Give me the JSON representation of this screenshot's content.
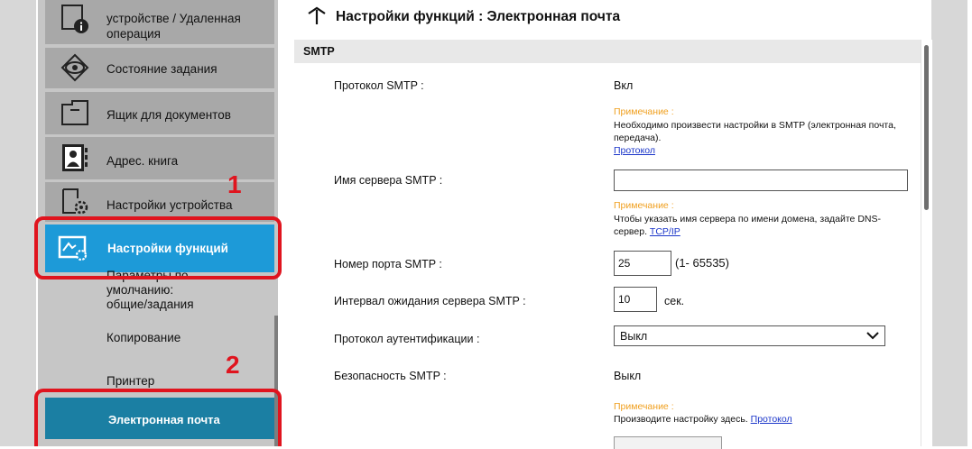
{
  "sidebar": {
    "items": [
      {
        "label_line1": "устройстве / Удаленная",
        "label_line2": "операция",
        "icon": "device-info-icon"
      },
      {
        "label": "Состояние задания",
        "icon": "eye-icon"
      },
      {
        "label": "Ящик для документов",
        "icon": "folder-icon"
      },
      {
        "label": "Адрес. книга",
        "icon": "address-book-icon"
      },
      {
        "label": "Настройки устройства",
        "icon": "device-settings-icon"
      }
    ],
    "active_item": {
      "label": "Настройки функций",
      "icon": "function-settings-icon"
    },
    "subitems": [
      {
        "line1": "Параметры по",
        "line2": "умолчанию:",
        "line3": "общие/задания"
      },
      {
        "label": "Копирование"
      },
      {
        "label": "Принтер"
      }
    ],
    "email_item": {
      "label": "Электронная почта"
    }
  },
  "callouts": {
    "first": "1",
    "second": "2"
  },
  "main": {
    "title": "Настройки функций : Электронная почта",
    "section": "SMTP",
    "smtp_protocol": {
      "label": "Протокол SMTP :",
      "value": "Вкл"
    },
    "note1": {
      "heading": "Примечание :",
      "text": "Необходимо произвести настройки в SMTP (электронная почта, передача).",
      "link": "Протокол"
    },
    "server_name": {
      "label": "Имя сервера SMTP :",
      "value": ""
    },
    "note2": {
      "heading": "Примечание :",
      "text": "Чтобы указать имя сервера по имени домена, задайте DNS-сервер.",
      "link": "TCP/IP"
    },
    "port": {
      "label": "Номер порта SMTP :",
      "value": "25",
      "range": "(1- 65535)"
    },
    "timeout": {
      "label": "Интервал ожидания сервера SMTP :",
      "value": "10",
      "unit": "сек."
    },
    "auth": {
      "label": "Протокол аутентификации :",
      "selected": "Выкл"
    },
    "security": {
      "label": "Безопасность SMTP :",
      "value": "Выкл"
    },
    "note3": {
      "heading": "Примечание :",
      "text": "Производите настройку здесь.",
      "link": "Протокол"
    }
  },
  "colors": {
    "accent": "#1d9ad8",
    "email_item": "#1b7fa3",
    "callout": "#e0141e",
    "note_heading": "#f0a020",
    "link": "#1a35c9"
  }
}
